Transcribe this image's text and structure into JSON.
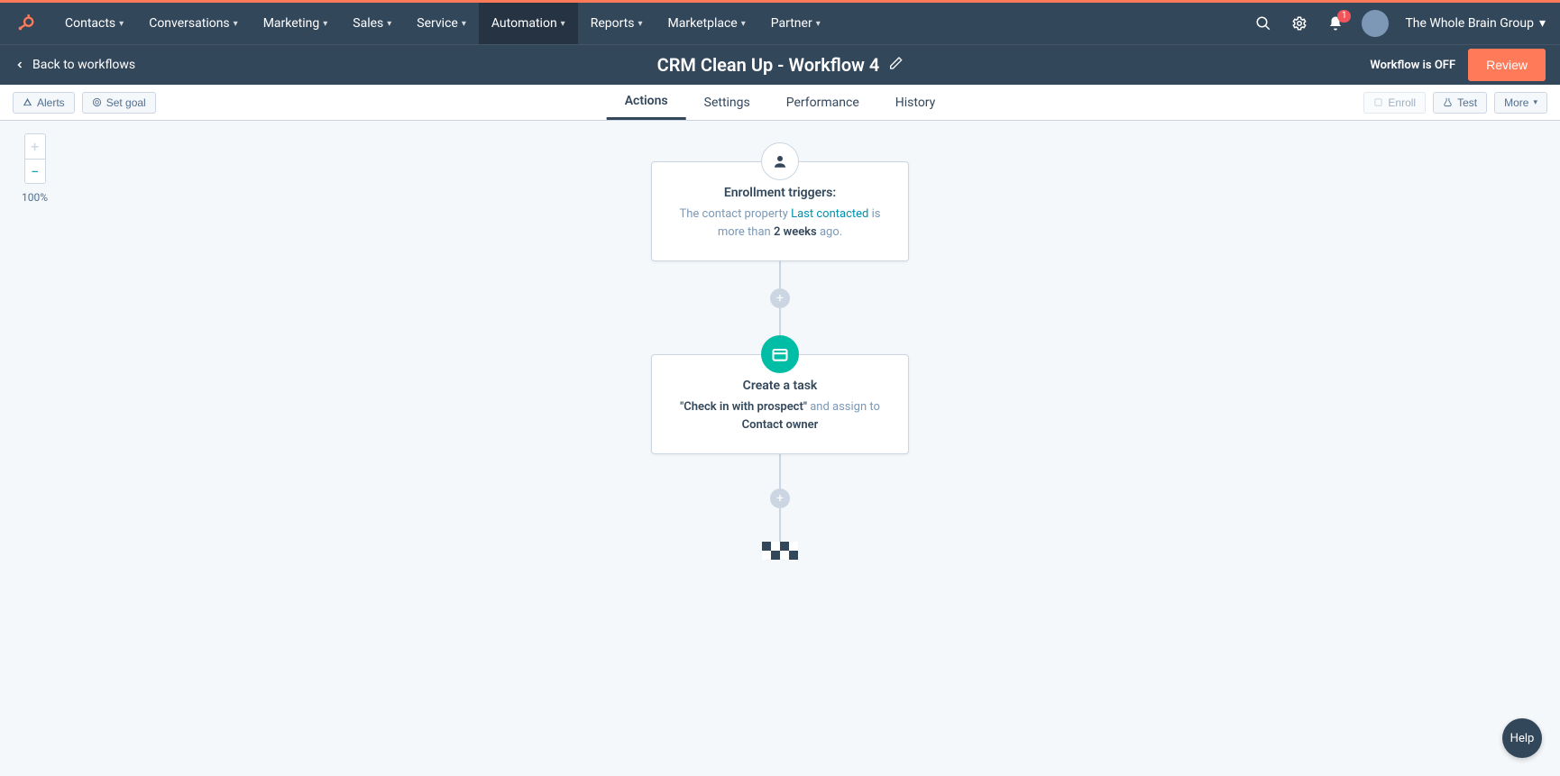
{
  "nav": {
    "items": [
      "Contacts",
      "Conversations",
      "Marketing",
      "Sales",
      "Service",
      "Automation",
      "Reports",
      "Marketplace",
      "Partner"
    ],
    "active_index": 5,
    "notification_count": "1",
    "account_name": "The Whole Brain Group"
  },
  "subheader": {
    "back_label": "Back to workflows",
    "workflow_title": "CRM Clean Up - Workflow 4",
    "status_text": "Workflow is OFF",
    "review_label": "Review"
  },
  "toolbar": {
    "alerts_label": "Alerts",
    "set_goal_label": "Set goal",
    "tabs": [
      "Actions",
      "Settings",
      "Performance",
      "History"
    ],
    "active_tab_index": 0,
    "enroll_label": "Enroll",
    "test_label": "Test",
    "more_label": "More"
  },
  "zoom": {
    "level_label": "100%"
  },
  "trigger_card": {
    "title": "Enrollment triggers:",
    "prefix": "The contact property ",
    "property": "Last contacted",
    "mid": " is more than ",
    "value": "2 weeks",
    "suffix": " ago."
  },
  "task_card": {
    "title": "Create a task",
    "task_name": "\"Check in with prospect\"",
    "mid": " and assign to ",
    "assignee": "Contact owner"
  },
  "help": {
    "label": "Help"
  }
}
